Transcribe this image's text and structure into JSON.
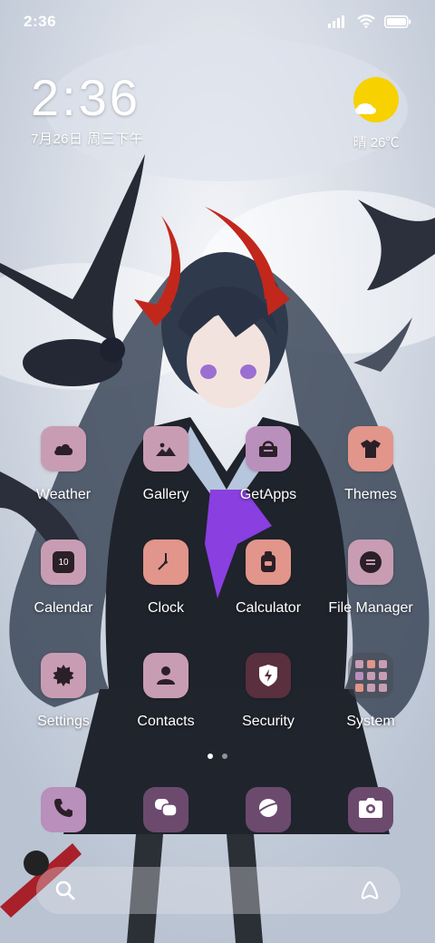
{
  "status_bar": {
    "time": "2:36",
    "icons": [
      "signal-icon",
      "wifi-icon",
      "battery-icon"
    ]
  },
  "clock_widget": {
    "time": "2:36",
    "date": "7月26日 周三下午"
  },
  "weather_widget": {
    "condition_icon": "sun-cloud-icon",
    "text": "晴 26℃"
  },
  "apps": [
    {
      "label": "Weather",
      "icon": "cloud-icon",
      "color": "#c89db3"
    },
    {
      "label": "Gallery",
      "icon": "mountain-image-icon",
      "color": "#c89db3"
    },
    {
      "label": "GetApps",
      "icon": "store-bag-icon",
      "color": "#b98fbb"
    },
    {
      "label": "Themes",
      "icon": "tshirt-icon",
      "color": "#e2958a"
    },
    {
      "label": "Calendar",
      "icon": "calendar-icon",
      "color": "#c89db3",
      "icon_text": "10"
    },
    {
      "label": "Clock",
      "icon": "clock-icon",
      "color": "#e2958a"
    },
    {
      "label": "Calculator",
      "icon": "calculator-icon",
      "color": "#e2958a"
    },
    {
      "label": "File Manager",
      "icon": "file-manager-icon",
      "color": "#c89db3"
    },
    {
      "label": "Settings",
      "icon": "gear-icon",
      "color": "#c89db3"
    },
    {
      "label": "Contacts",
      "icon": "person-icon",
      "color": "#c89db3"
    },
    {
      "label": "Security",
      "icon": "shield-bolt-icon",
      "color": "#5a2f3e"
    },
    {
      "label": "System",
      "icon": "folder-icon",
      "color": "#5a5563"
    }
  ],
  "page_indicator": {
    "pages": 2,
    "active": 0
  },
  "dock": [
    {
      "name": "phone",
      "icon": "phone-icon",
      "color": "#b98fbb"
    },
    {
      "name": "messages",
      "icon": "chat-bubbles-icon",
      "color": "#6c4a6e"
    },
    {
      "name": "browser",
      "icon": "planet-browser-icon",
      "color": "#6c4a6e"
    },
    {
      "name": "camera",
      "icon": "camera-icon",
      "color": "#6c4a6e"
    }
  ],
  "search_bar": {
    "placeholder": ""
  },
  "colors": {
    "accent_pink": "#c89db3",
    "accent_salmon": "#e2958a",
    "dark_plum": "#6c4a6e",
    "weather_sun": "#f7d100"
  }
}
